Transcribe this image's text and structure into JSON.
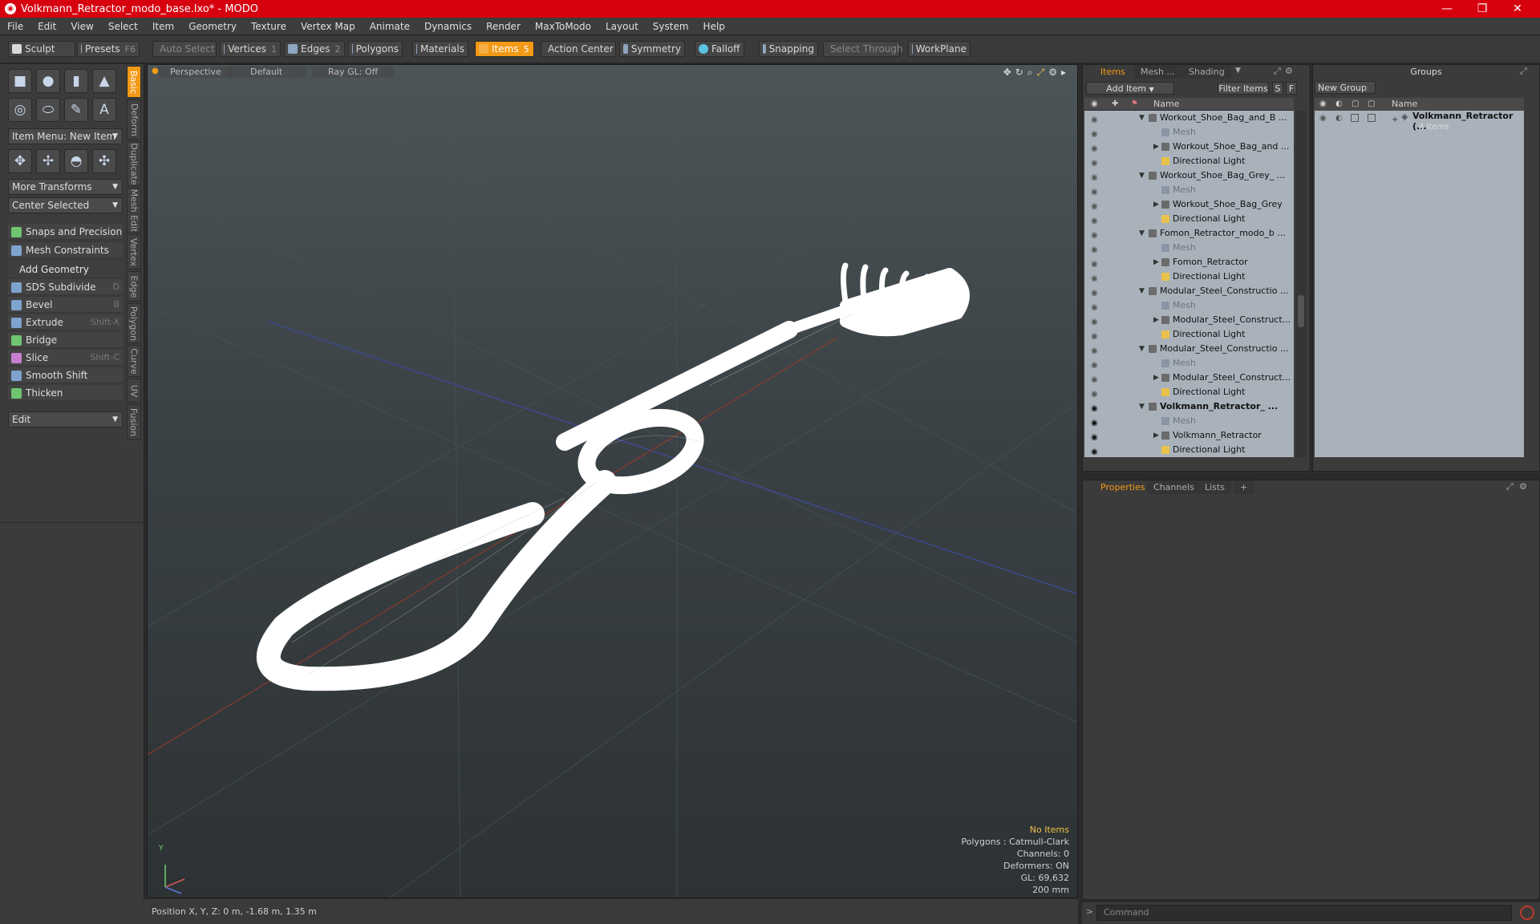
{
  "window": {
    "title": "Volkmann_Retractor_modo_base.lxo* - MODO"
  },
  "menu": [
    "File",
    "Edit",
    "View",
    "Select",
    "Item",
    "Geometry",
    "Texture",
    "Vertex Map",
    "Animate",
    "Dynamics",
    "Render",
    "MaxToModo",
    "Layout",
    "System",
    "Help"
  ],
  "toolbar": {
    "sculpt": "Sculpt",
    "presets": "Presets",
    "presets_key": "F6",
    "auto_select": "Auto Select",
    "vertices": "Vertices",
    "vertices_count": "1",
    "edges": "Edges",
    "edges_count": "2",
    "polygons": "Polygons",
    "materials": "Materials",
    "items": "Items",
    "items_count": "5",
    "action_center": "Action Center",
    "symmetry": "Symmetry",
    "falloff": "Falloff",
    "snapping": "Snapping",
    "select_through": "Select Through",
    "workplane": "WorkPlane"
  },
  "left": {
    "item_menu": "Item Menu: New Item",
    "more_transforms": "More Transforms",
    "center_selected": "Center Selected",
    "snaps": "Snaps and Precision",
    "mesh_constraints": "Mesh Constraints",
    "add_geometry": "Add Geometry",
    "tools": [
      {
        "label": "SDS Subdivide",
        "key": "D"
      },
      {
        "label": "Bevel",
        "key": "B"
      },
      {
        "label": "Extrude",
        "key": "Shift-X"
      },
      {
        "label": "Bridge",
        "key": ""
      },
      {
        "label": "Slice",
        "key": "Shift-C"
      },
      {
        "label": "Smooth Shift",
        "key": ""
      },
      {
        "label": "Thicken",
        "key": ""
      }
    ],
    "edit": "Edit",
    "vtabs": [
      "Basic",
      "Deform",
      "Duplicate",
      "Mesh Edit",
      "Vertex",
      "Edge",
      "Polygon",
      "Curve",
      "UV",
      "Fusion"
    ]
  },
  "viewport": {
    "view": "Perspective",
    "shading": "Default",
    "raygl": "Ray GL: Off",
    "stats": {
      "items": "No Items",
      "polygons": "Polygons : Catmull-Clark",
      "channels": "Channels: 0",
      "deformers": "Deformers: ON",
      "gl": "GL: 69,632",
      "scale": "200 mm"
    },
    "axis_y": "Y"
  },
  "status": {
    "position": "Position X, Y, Z:  0 m, -1.68 m, 1.35 m"
  },
  "items_panel": {
    "tabs": [
      "Items",
      "Mesh ...",
      "Shading"
    ],
    "add_item": "Add Item",
    "filter_items": "Filter Items",
    "s": "S",
    "f": "F",
    "col_name": "Name",
    "rows": [
      {
        "type": "grp",
        "label": "Workout_Shoe_Bag_and_B ..."
      },
      {
        "type": "mesh",
        "label": "Mesh"
      },
      {
        "type": "item",
        "label": "Workout_Shoe_Bag_and ..."
      },
      {
        "type": "light",
        "label": "Directional Light"
      },
      {
        "type": "grp",
        "label": "Workout_Shoe_Bag_Grey_ ..."
      },
      {
        "type": "mesh",
        "label": "Mesh"
      },
      {
        "type": "item",
        "label": "Workout_Shoe_Bag_Grey"
      },
      {
        "type": "light",
        "label": "Directional Light"
      },
      {
        "type": "grp",
        "label": "Fomon_Retractor_modo_b ..."
      },
      {
        "type": "mesh",
        "label": "Mesh"
      },
      {
        "type": "item",
        "label": "Fomon_Retractor"
      },
      {
        "type": "light",
        "label": "Directional Light"
      },
      {
        "type": "grp",
        "label": "Modular_Steel_Constructio ..."
      },
      {
        "type": "mesh",
        "label": "Mesh"
      },
      {
        "type": "item",
        "label": "Modular_Steel_Construct..."
      },
      {
        "type": "light",
        "label": "Directional Light"
      },
      {
        "type": "grp",
        "label": "Modular_Steel_Constructio ..."
      },
      {
        "type": "mesh",
        "label": "Mesh"
      },
      {
        "type": "item",
        "label": "Modular_Steel_Construct..."
      },
      {
        "type": "light",
        "label": "Directional Light"
      },
      {
        "type": "grp",
        "bold": true,
        "label": "Volkmann_Retractor_ ..."
      },
      {
        "type": "mesh",
        "label": "Mesh"
      },
      {
        "type": "item",
        "label": "Volkmann_Retractor"
      },
      {
        "type": "light",
        "label": "Directional Light"
      }
    ]
  },
  "groups_panel": {
    "title": "Groups",
    "new_group": "New Group",
    "col_name": "Name",
    "group_name": "Volkmann_Retractor (...",
    "group_count": "4 Items"
  },
  "props_panel": {
    "tabs": [
      "Properties",
      "Channels",
      "Lists"
    ],
    "plus": "+"
  },
  "command": {
    "placeholder": "Command"
  }
}
